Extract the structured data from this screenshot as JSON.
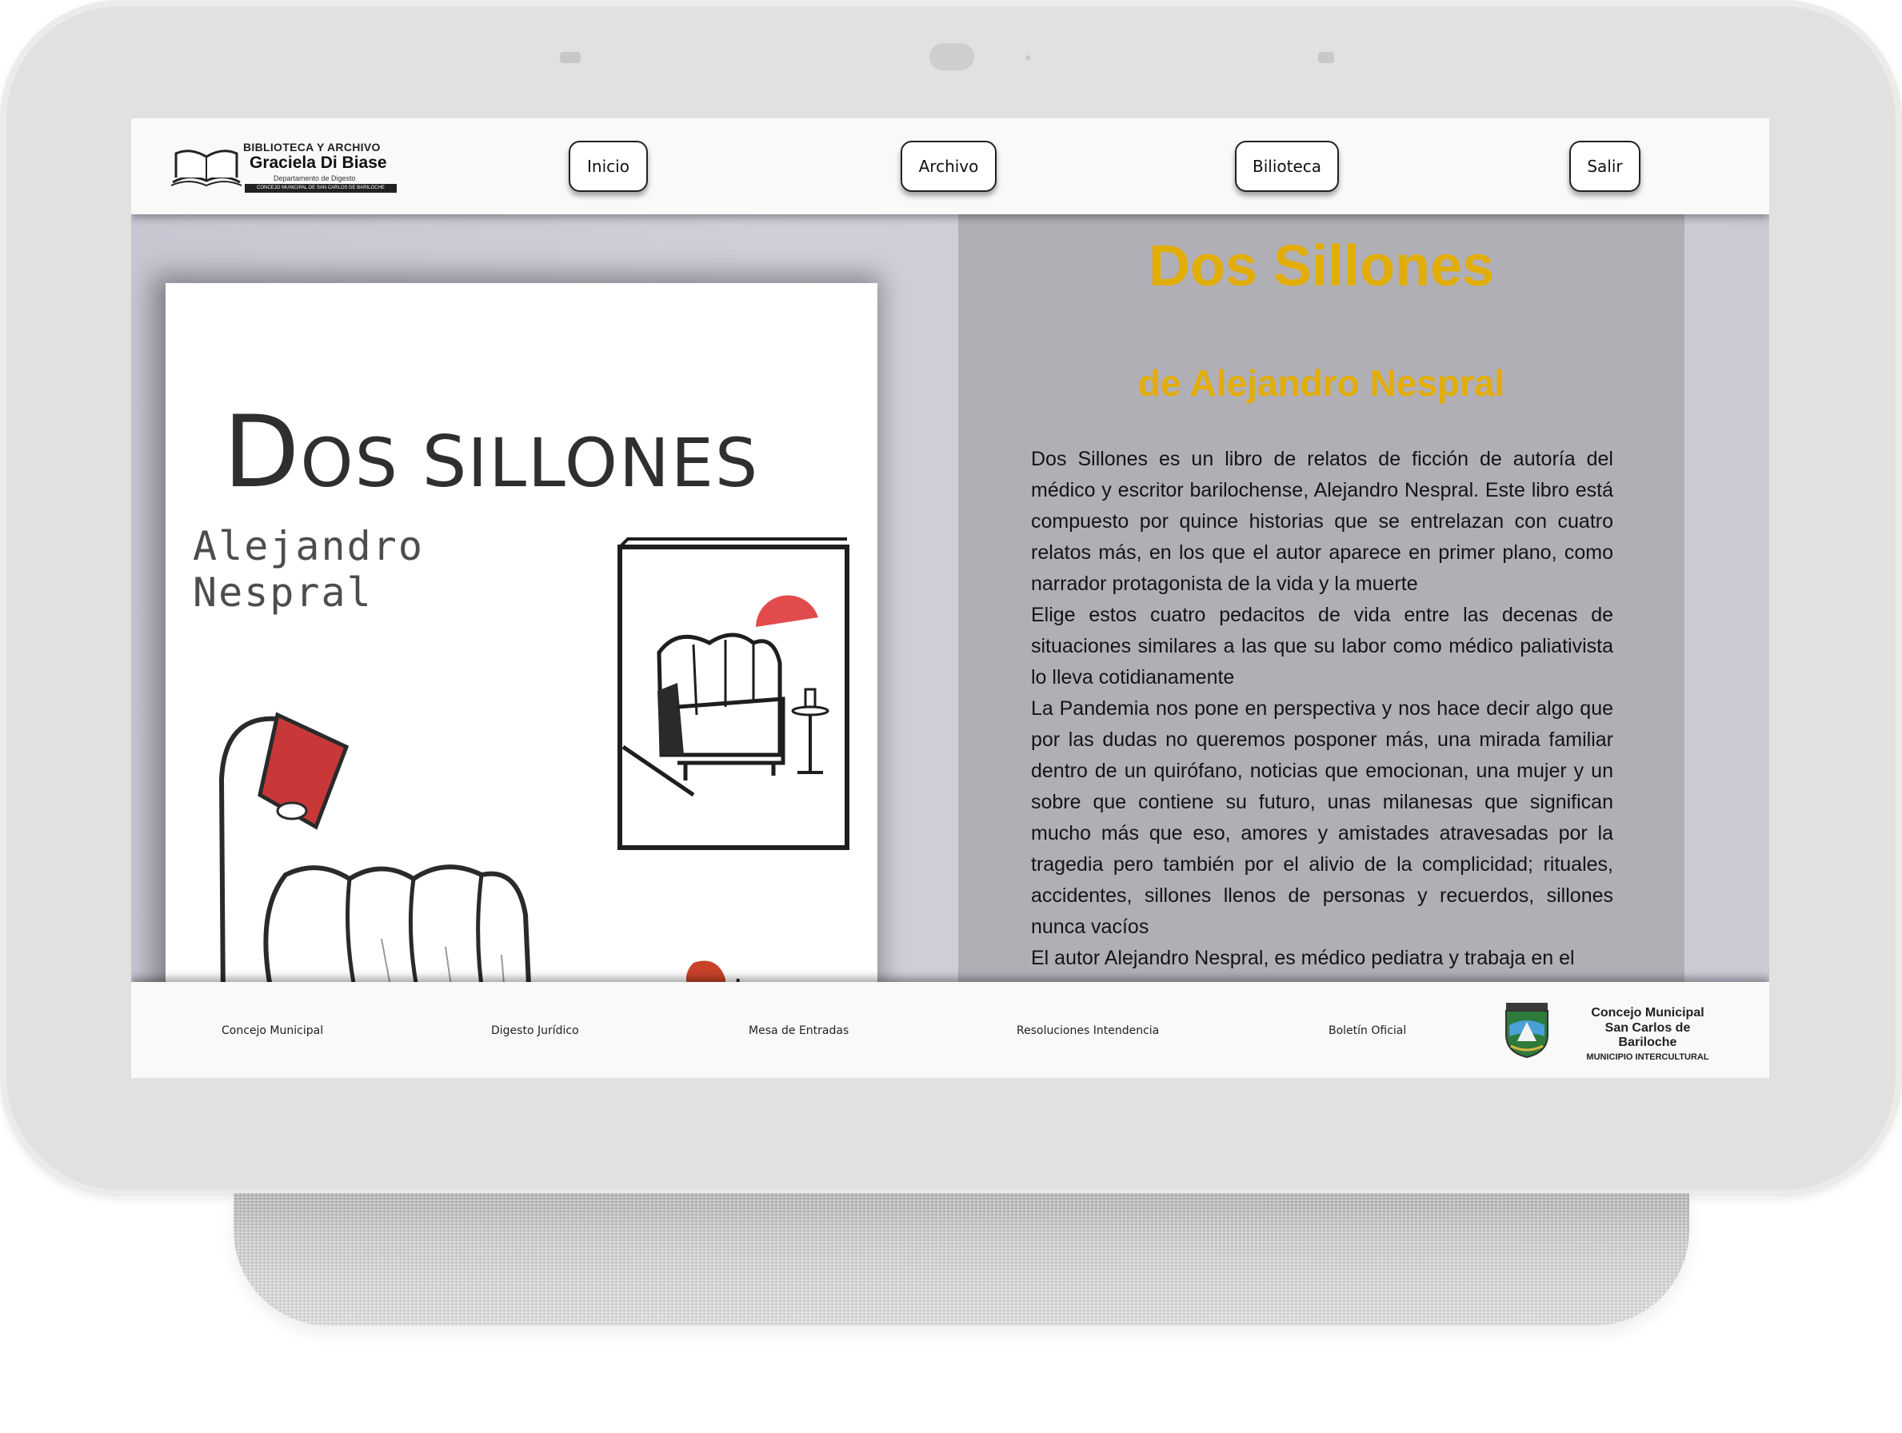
{
  "header": {
    "logo": {
      "line1": "BIBLIOTECA Y ARCHIVO",
      "line2": "Graciela Di Biase",
      "line3": "Departamento de Digesto",
      "line4": "CONCEJO MUNICIPAL DE SAN CARLOS DE BARILOCHE"
    },
    "nav": [
      "Inicio",
      "Archivo",
      "Bilioteca",
      "Salir"
    ]
  },
  "cover": {
    "title_big_1": "D",
    "title_small_1": "OS ",
    "title_big_2": "S",
    "title_small_2": "ILLONES",
    "author_line1": "Alejandro",
    "author_line2": "Nespral"
  },
  "book": {
    "title": "Dos Sillones",
    "author": "de Alejandro Nespral",
    "description": [
      "Dos Sillones es un libro de relatos de ficción de autoría del médico y escritor barilochense, Alejandro Nespral. Este libro está compuesto por quince historias que se entrelazan con cuatro relatos más, en los que el autor aparece en primer plano, como narrador protagonista de la vida y la muerte",
      "Elige estos cuatro pedacitos de vida entre las decenas de situaciones similares a las que su labor como médico paliativista lo lleva cotidianamente",
      "La Pandemia nos pone en perspectiva y nos hace decir algo que por las dudas no queremos posponer más, una mirada familiar dentro de un quirófano, noticias que emocionan, una mujer y un sobre que contiene su futuro, unas milanesas que significan mucho más que eso, amores y amistades atravesadas por la tragedia pero también por el alivio de la complicidad; rituales, accidentes, sillones llenos de personas y recuerdos, sillones nunca vacíos",
      "El autor Alejandro Nespral, es médico pediatra y trabaja en el"
    ]
  },
  "footer": {
    "links": [
      "Concejo Municipal",
      "Digesto Jurídico",
      "Mesa de Entradas",
      "Resoluciones Intendencia",
      "Boletín Oficial"
    ],
    "municipality": {
      "line1": "Concejo Municipal",
      "line2": "San Carlos de Bariloche",
      "line3": "MUNICIPIO INTERCULTURAL"
    }
  },
  "colors": {
    "title": "#e2ad06",
    "panel": "#b1afb6",
    "background": "#c9c8d4",
    "bar": "#f9f9f8"
  }
}
